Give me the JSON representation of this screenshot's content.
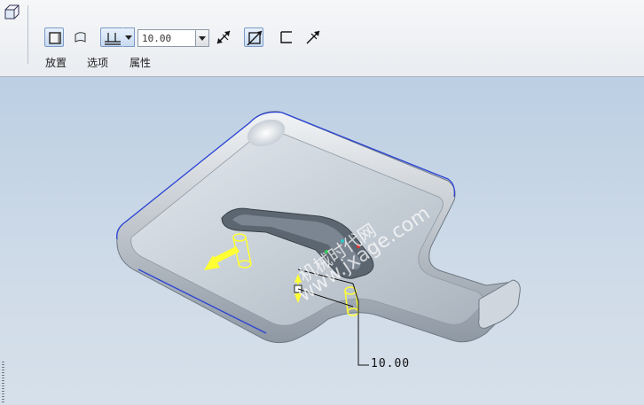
{
  "toolbar": {
    "tabs": [
      {
        "label": "放置"
      },
      {
        "label": "选项"
      },
      {
        "label": "属性"
      }
    ],
    "depth": {
      "value": "10.00"
    }
  },
  "viewport": {
    "dimension_label": "10.00",
    "watermark_line1": "机械时代网",
    "watermark_line2": "www.jxage.com"
  },
  "colors": {
    "toolbar_bg": "#eef0f3",
    "viewport_top": "#bccfe3",
    "part_surface": "#c9d1d9",
    "edge_highlight": "#2b43d6",
    "preview": "#ffff33"
  }
}
